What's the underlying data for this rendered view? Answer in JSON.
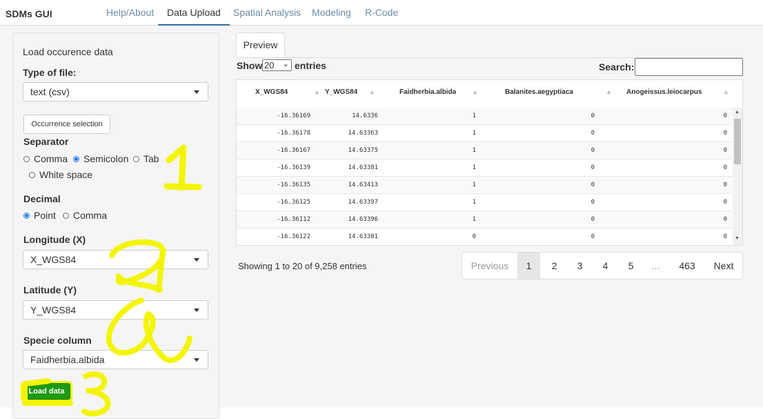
{
  "app": {
    "brand": "SDMs GUI"
  },
  "nav": {
    "tabs": [
      {
        "label": "Help/About"
      },
      {
        "label": "Data Upload"
      },
      {
        "label": "Spatial Analysis"
      },
      {
        "label": "Modeling"
      },
      {
        "label": "R-Code"
      }
    ]
  },
  "sidebar": {
    "title": "Load occurence data",
    "type_label": "Type of file:",
    "type_value": "text (csv)",
    "occ_button": "Occurrence selection",
    "separator_label": "Separator",
    "separator_options": [
      "Comma",
      "Semicolon",
      "Tab",
      "White space"
    ],
    "separator_selected": "Semicolon",
    "decimal_label": "Decimal",
    "decimal_options": [
      "Point",
      "Comma"
    ],
    "decimal_selected": "Point",
    "lon_label": "Longitude (X)",
    "lon_value": "X_WGS84",
    "lat_label": "Latitude (Y)",
    "lat_value": "Y_WGS84",
    "specie_label": "Specie column",
    "specie_value": "Faidherbia.albida",
    "load_button": "Load data"
  },
  "main": {
    "tab": "Preview",
    "show_label": "Show",
    "page_length": "20",
    "entries_label": "entries",
    "search_label": "Search:",
    "search_value": "",
    "columns": [
      "X_WGS84",
      "Y_WGS84",
      "Faidherbia.albida",
      "Balanites.aegyptiaca",
      "Anogeissus.leiocarpus"
    ],
    "rows": [
      [
        "-16.36169",
        "14.6336",
        "1",
        "0",
        "0"
      ],
      [
        "-16.36178",
        "14.63363",
        "1",
        "0",
        "0"
      ],
      [
        "-16.36167",
        "14.63375",
        "1",
        "0",
        "0"
      ],
      [
        "-16.36139",
        "14.63381",
        "1",
        "0",
        "0"
      ],
      [
        "-16.36135",
        "14.63413",
        "1",
        "0",
        "0"
      ],
      [
        "-16.36125",
        "14.63397",
        "1",
        "0",
        "0"
      ],
      [
        "-16.36112",
        "14.63396",
        "1",
        "0",
        "0"
      ],
      [
        "-16.36122",
        "14.63301",
        "0",
        "0",
        "0"
      ]
    ],
    "info": "Showing 1 to 20 of 9,258 entries",
    "pagination": {
      "previous": "Previous",
      "pages": [
        "1",
        "2",
        "3",
        "4",
        "5",
        "…",
        "463"
      ],
      "next": "Next",
      "current": "1"
    }
  },
  "colors": {
    "accent": "#2c6fa5",
    "load_button": "#1f9a14",
    "highlight": "#f3f500",
    "radio": "#1a73e8"
  },
  "annotations": [
    "1",
    "2",
    "3"
  ]
}
